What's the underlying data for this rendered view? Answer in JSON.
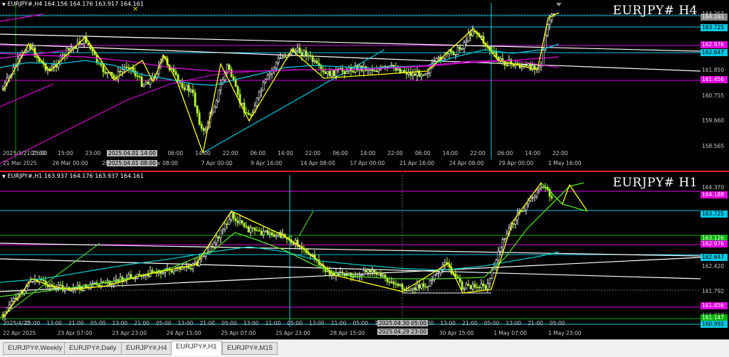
{
  "top_chart": {
    "info": "EURJPY#,H4 164.156 164.176 163.917 164.161",
    "title": "EURJPY# H4",
    "price_labels": [
      {
        "text": "164.297",
        "price": 164.297,
        "bg": "",
        "fg": "#c8c8c8"
      },
      {
        "text": "164.161",
        "price": 164.161,
        "bg": "#8a8a8a",
        "fg": "#ffffff"
      },
      {
        "text": "163.725",
        "price": 163.725,
        "bg": "#00c8e6",
        "fg": "#000000"
      },
      {
        "text": "162.976",
        "price": 162.976,
        "bg": "#e000e0",
        "fg": "#ffffff"
      },
      {
        "text": "162.647",
        "price": 162.647,
        "bg": "#00c8e6",
        "fg": "#000000"
      },
      {
        "text": "161.850",
        "price": 161.85,
        "bg": "",
        "fg": "#c8c8c8"
      },
      {
        "text": "161.456",
        "price": 161.456,
        "bg": "#e000e0",
        "fg": "#ffffff"
      },
      {
        "text": "160.755",
        "price": 160.755,
        "bg": "",
        "fg": "#c8c8c8"
      },
      {
        "text": "159.660",
        "price": 159.66,
        "bg": "",
        "fg": "#c8c8c8"
      },
      {
        "text": "158.565",
        "price": 158.565,
        "bg": "",
        "fg": "#c8c8c8"
      }
    ],
    "time_upper": [
      "2025/3/21 23:00",
      "07:00",
      "15:00",
      "23:00",
      "14:00",
      "22:00",
      "06:00",
      "14:00",
      "22:00",
      "06:00",
      "14:00",
      "22:00",
      "06:00",
      "14:00",
      "22:00",
      "06:00",
      "14:00",
      "22:00",
      "06:00",
      "14:00",
      "22:00"
    ],
    "time_lower": [
      "21 Mar 2025",
      "26 Mar 00:00",
      "28 Mar 08:00",
      "Apr 08:00",
      "7 Apr 00:00",
      "9 Apr 16:00",
      "14 Apr 08:00",
      "17 Apr 00:00",
      "21 Apr 16:00",
      "24 Apr 08:00",
      "29 Apr 00:00",
      "1 May 16:00"
    ],
    "crosshair_boxes": [
      "2025.04.01 14:00",
      "2025.04.01 08:00"
    ]
  },
  "bottom_chart": {
    "info": "EURJPY#,H1 163.937 164.176 163.937 164.161",
    "title": "EURJPY# H1",
    "price_labels": [
      {
        "text": "164.370",
        "price": 164.37,
        "bg": "",
        "fg": "#c8c8c8"
      },
      {
        "text": "164.188",
        "price": 164.188,
        "bg": "#e000e0",
        "fg": "#ffffff"
      },
      {
        "text": "163.725",
        "price": 163.725,
        "bg": "#00c8e6",
        "fg": "#000000"
      },
      {
        "text": "163.126",
        "price": 163.126,
        "bg": "#00b400",
        "fg": "#ffffff"
      },
      {
        "text": "162.976",
        "price": 162.976,
        "bg": "#e000e0",
        "fg": "#ffffff"
      },
      {
        "text": "162.647",
        "price": 162.647,
        "bg": "#00c8e6",
        "fg": "#000000"
      },
      {
        "text": "162.420",
        "price": 162.42,
        "bg": "",
        "fg": "#c8c8c8"
      },
      {
        "text": "161.792",
        "price": 161.792,
        "bg": "",
        "fg": "#c8c8c8"
      },
      {
        "text": "161.456",
        "price": 161.456,
        "bg": "#e000e0",
        "fg": "#ffffff"
      },
      {
        "text": "161.210",
        "price": 161.21,
        "bg": "",
        "fg": "#c8c8c8"
      },
      {
        "text": "161.147",
        "price": 161.147,
        "bg": "#00b400",
        "fg": "#ffffff"
      },
      {
        "text": "160.991",
        "price": 160.991,
        "bg": "#00c8e6",
        "fg": "#000000"
      }
    ],
    "time_upper": [
      "2025/4/22",
      "25:00",
      "13:00",
      "21:00",
      "05:00",
      "13:00",
      "21:00",
      "05:00",
      "13:00",
      "21:00",
      "05:00",
      "13:00",
      "21:00",
      "05:00",
      "13:00",
      "21:00",
      "05:00",
      "13:00",
      "21:00",
      "05:00",
      "13:00",
      "21:00",
      "05:00",
      "13:00",
      "21:00",
      "05:00"
    ],
    "time_lower": [
      "22 Apr 2025",
      "23 Apr 07:00",
      "23 Apr 23:00",
      "24 Apr 15:00",
      "25 Apr 07:00",
      "25 Apr 23:00",
      "28 Apr 15:00",
      "29 Apr 07:",
      "30 Apr 15:00",
      "1 May 07:00",
      "1 May 23:00"
    ],
    "crosshair_boxes": [
      "2025.04.30 05:00",
      "2025.04.29 23:00"
    ]
  },
  "tabs": [
    {
      "label": "EURJPY#,Weekly",
      "active": false
    },
    {
      "label": "EURJPY#,Daily",
      "active": false
    },
    {
      "label": "EURJPY#,H4",
      "active": false
    },
    {
      "label": "EURJPY#,H1",
      "active": true
    },
    {
      "label": "EURJPY#,M15",
      "active": false
    }
  ],
  "colors": {
    "background": "#000000",
    "bull_candle": "#ffffff",
    "bear_candle": "#b4ff32",
    "zigzag": "#ffff00",
    "ma_cyan": "#00c8e6",
    "ma_magenta": "#e000e0",
    "ma_green": "#00c800",
    "trendline_white": "#ffffff",
    "separator": "#e02020"
  }
}
